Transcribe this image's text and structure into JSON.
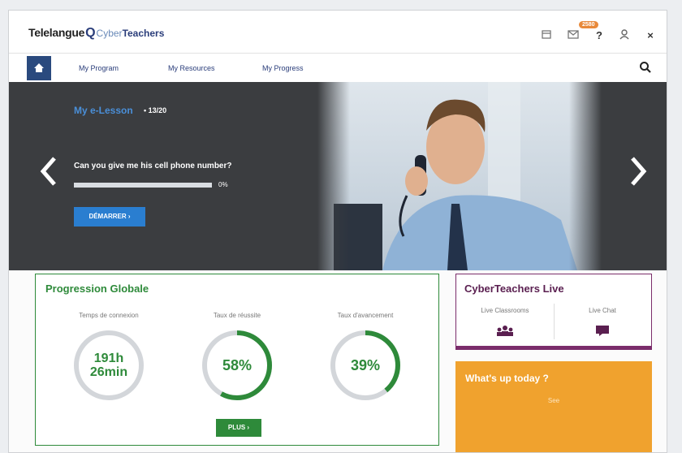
{
  "header": {
    "logo_part1": "Telelangue",
    "logo_part2": "Cyber",
    "logo_part3": "Teachers",
    "badge": "2580"
  },
  "nav": {
    "items": [
      "My Program",
      "My Resources",
      "My Progress"
    ]
  },
  "hero": {
    "lesson_title": "My e-Lesson",
    "lesson_count": "• 13/20",
    "question": "Can you give me his cell phone number?",
    "progress_pct": "0%",
    "progress_value": 0,
    "start_label": "DÉMARRER ›"
  },
  "progression": {
    "title": "Progression Globale",
    "metrics": [
      {
        "label": "Temps de connexion",
        "value_line1": "191h",
        "value_line2": "26min",
        "fraction": 0
      },
      {
        "label": "Taux de réussite",
        "value_line1": "58%",
        "value_line2": "",
        "fraction": 0.58
      },
      {
        "label": "Taux d'avancement",
        "value_line1": "39%",
        "value_line2": "",
        "fraction": 0.39
      }
    ],
    "plus_label": "PLUS ›"
  },
  "live": {
    "title": "CyberTeachers Live",
    "options": [
      "Live Classrooms",
      "Live Chat"
    ]
  },
  "whats_up": {
    "title": "What's up today ?",
    "subtitle": "See"
  },
  "colors": {
    "accent_blue": "#2a7ed0",
    "nav_blue": "#2a4a7e",
    "green": "#2e8a3a",
    "purple": "#7b2d6b",
    "orange": "#f0a22e"
  }
}
